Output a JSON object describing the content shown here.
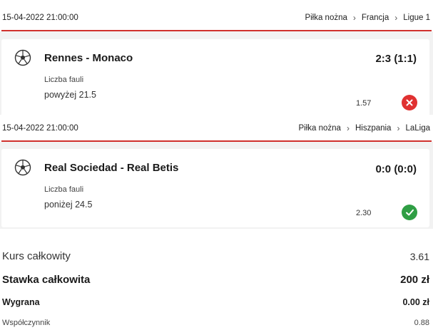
{
  "bets": [
    {
      "datetime": "15-04-2022 21:00:00",
      "breadcrumb": [
        "Piłka nożna",
        "Francja",
        "Ligue 1"
      ],
      "teams": "Rennes - Monaco",
      "score": "2:3 (1:1)",
      "market": "Liczba fauli",
      "pick": "powyżej 21.5",
      "odds": "1.57",
      "result": "lost",
      "result_color": "#e03131"
    },
    {
      "datetime": "15-04-2022 21:00:00",
      "breadcrumb": [
        "Piłka nożna",
        "Hiszpania",
        "LaLiga"
      ],
      "teams": "Real Sociedad - Real Betis",
      "score": "0:0 (0:0)",
      "market": "Liczba fauli",
      "pick": "poniżej 24.5",
      "odds": "2.30",
      "result": "won",
      "result_color": "#2f9e44"
    }
  ],
  "summary": {
    "total_odds_label": "Kurs całkowity",
    "total_odds_value": "3.61",
    "total_stake_label": "Stawka całkowita",
    "total_stake_value": "200 zł",
    "win_label": "Wygrana",
    "win_value": "0.00 zł",
    "coef_label": "Współczynnik",
    "coef_value": "0.88"
  },
  "colors": {
    "accent_line": "#d0312d",
    "page_gray": "#f2f2f2"
  }
}
